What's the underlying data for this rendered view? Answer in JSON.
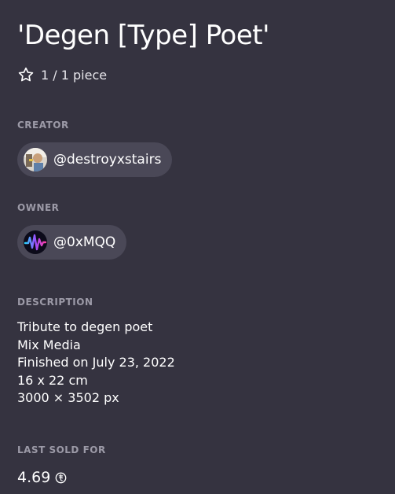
{
  "artwork": {
    "title": "'Degen [Type] Poet'",
    "edition": "1 / 1 piece"
  },
  "creator": {
    "label": "CREATOR",
    "handle": "@destroyxstairs"
  },
  "owner": {
    "label": "OWNER",
    "handle": "@0xMQQ"
  },
  "description": {
    "label": "DESCRIPTION",
    "lines": [
      "Tribute to degen poet",
      "Mix Media",
      "Finished on July 23, 2022",
      "16 x 22 cm",
      "3000 × 3502 px"
    ]
  },
  "last_sold": {
    "label": "LAST SOLD FOR",
    "amount": "4.69"
  },
  "colors": {
    "background": "#353340",
    "chip": "#4a4857",
    "muted_label": "#9c9aa7"
  },
  "icons": {
    "edition": "star-outline-icon",
    "currency": "tezos-icon"
  }
}
